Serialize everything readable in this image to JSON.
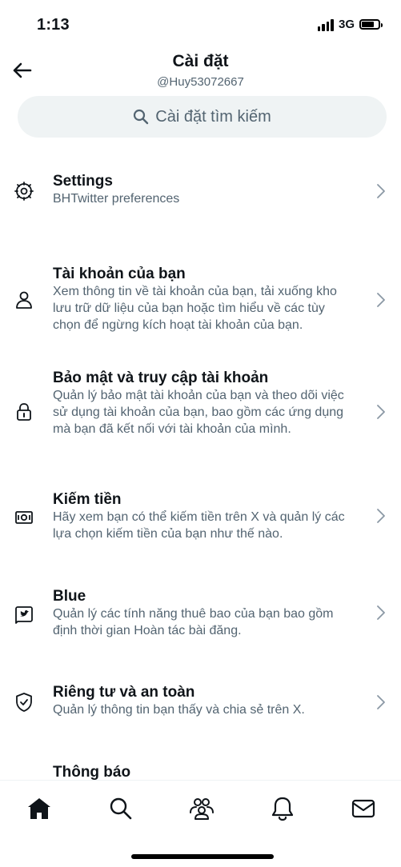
{
  "status_bar": {
    "time": "1:13",
    "network": "3G",
    "battery_level": 0.85
  },
  "header": {
    "title": "Cài đặt",
    "handle": "@Huy53072667"
  },
  "search": {
    "placeholder": "Cài đặt tìm kiếm"
  },
  "items": [
    {
      "icon": "settings-gear-icon",
      "title": "Settings",
      "description": "BHTwitter preferences"
    },
    {
      "icon": "user-icon",
      "title": "Tài khoản của bạn",
      "description": "Xem thông tin về tài khoản của bạn, tải xuống kho lưu trữ dữ liệu của bạn hoặc tìm hiểu về các tùy chọn để ngừng kích hoạt tài khoản của bạn."
    },
    {
      "icon": "lock-icon",
      "title": "Bảo mật và truy cập tài khoản",
      "description": "Quản lý bảo mật tài khoản của bạn và theo dõi việc sử dụng tài khoản của bạn, bao gồm các ứng dụng mà bạn đã kết nối với tài khoản của mình."
    },
    {
      "icon": "money-icon",
      "title": "Kiếm tiền",
      "description": "Hãy xem bạn có thể kiếm tiền trên X và quản lý các lựa chọn kiếm tiền của bạn như thế nào."
    },
    {
      "icon": "blue-bird-icon",
      "title": "Blue",
      "description": "Quản lý các tính năng thuê bao của bạn bao gồm định thời gian Hoàn tác bài đăng."
    },
    {
      "icon": "shield-check-icon",
      "title": "Riêng tư và an toàn",
      "description": "Quản lý thông tin bạn thấy và chia sẻ trên X."
    },
    {
      "icon": "",
      "title": "Thông báo",
      "description": ""
    }
  ],
  "tabbar": [
    "home-icon",
    "search-icon",
    "communities-icon",
    "notifications-bell-icon",
    "messages-envelope-icon"
  ]
}
